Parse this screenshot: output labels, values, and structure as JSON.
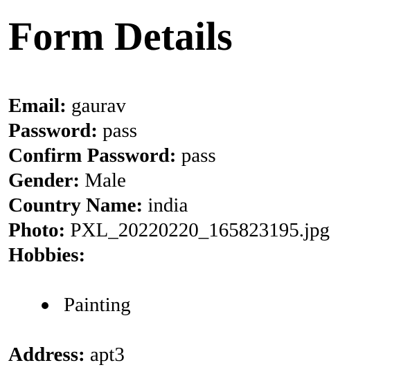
{
  "page_title": "Form Details",
  "fields": {
    "email": {
      "label": "Email:",
      "value": "gaurav"
    },
    "password": {
      "label": "Password:",
      "value": "pass"
    },
    "confirm_password": {
      "label": "Confirm Password:",
      "value": "pass"
    },
    "gender": {
      "label": "Gender:",
      "value": "Male"
    },
    "country": {
      "label": "Country Name:",
      "value": "india"
    },
    "photo": {
      "label": "Photo:",
      "value": "PXL_20220220_165823195.jpg"
    },
    "hobbies": {
      "label": "Hobbies:"
    },
    "address": {
      "label": "Address:",
      "value": "apt3"
    }
  },
  "hobbies_list": [
    "Painting"
  ]
}
